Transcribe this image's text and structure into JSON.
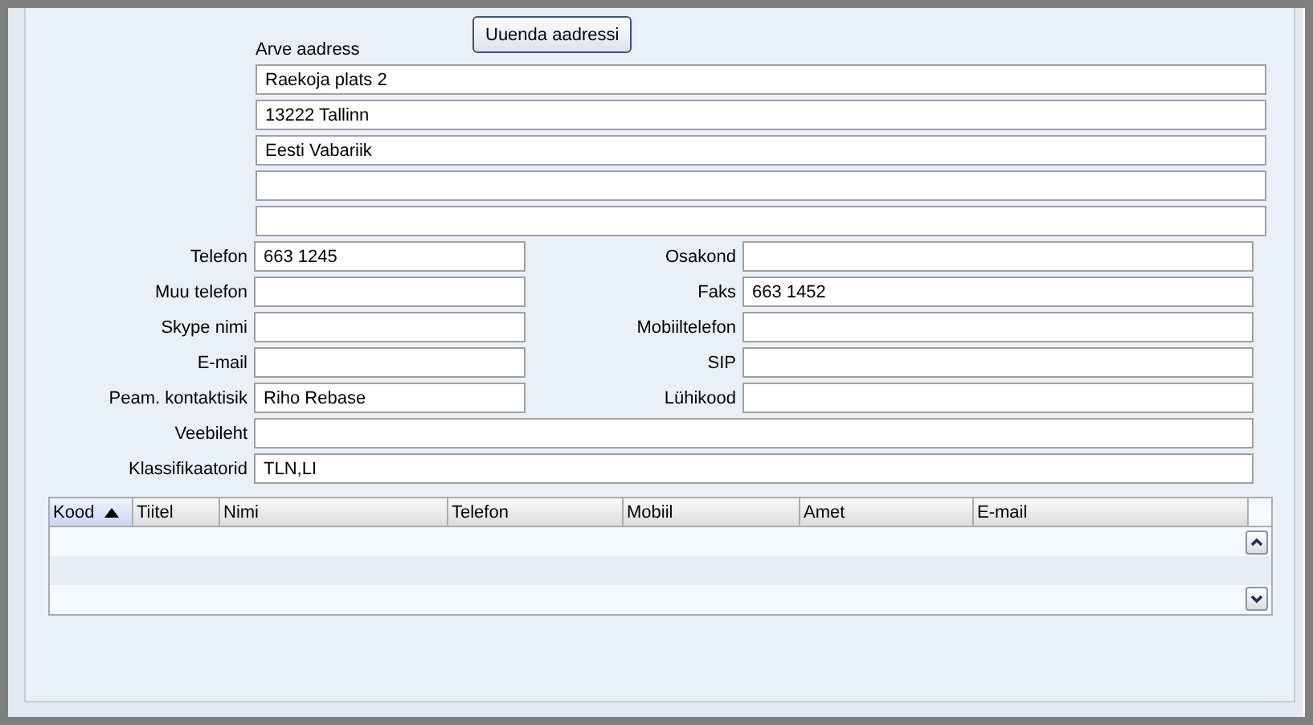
{
  "update_button": {
    "label": "Uuenda aadressi"
  },
  "address": {
    "label": "Arve aadress",
    "lines": [
      "Raekoja plats 2",
      "13222 Tallinn",
      "Eesti Vabariik"
    ]
  },
  "fields": [
    {
      "kind": "half",
      "label": "Telefon",
      "value": "663 1245"
    },
    {
      "kind": "half",
      "label": "Osakond"
    },
    {
      "kind": "half",
      "label": "Muu telefon"
    },
    {
      "kind": "half",
      "label": "Faks",
      "value": "663 1452"
    },
    {
      "kind": "half",
      "label": "Skype nimi"
    },
    {
      "kind": "half",
      "label": "Mobiiltelefon"
    },
    {
      "kind": "half",
      "label": "E-mail"
    },
    {
      "kind": "half",
      "label": "SIP"
    },
    {
      "kind": "half",
      "label": "Peam. kontaktisik",
      "value": "Riho Rebase"
    },
    {
      "kind": "half",
      "label": "Lühikood"
    },
    {
      "kind": "wide",
      "label": "Veebileht"
    },
    {
      "kind": "wide",
      "label": "Klassifikaatorid",
      "value": "TLN,LI"
    }
  ],
  "table": {
    "columns": [
      {
        "label": "Kood",
        "sorted": true
      },
      {
        "label": "Tiitel",
        "sorted": false
      },
      {
        "label": "Nimi",
        "sorted": false
      },
      {
        "label": "Telefon",
        "sorted": false
      },
      {
        "label": "Mobiil",
        "sorted": false
      },
      {
        "label": "Amet",
        "sorted": false
      },
      {
        "label": "E-mail",
        "sorted": false
      }
    ]
  }
}
